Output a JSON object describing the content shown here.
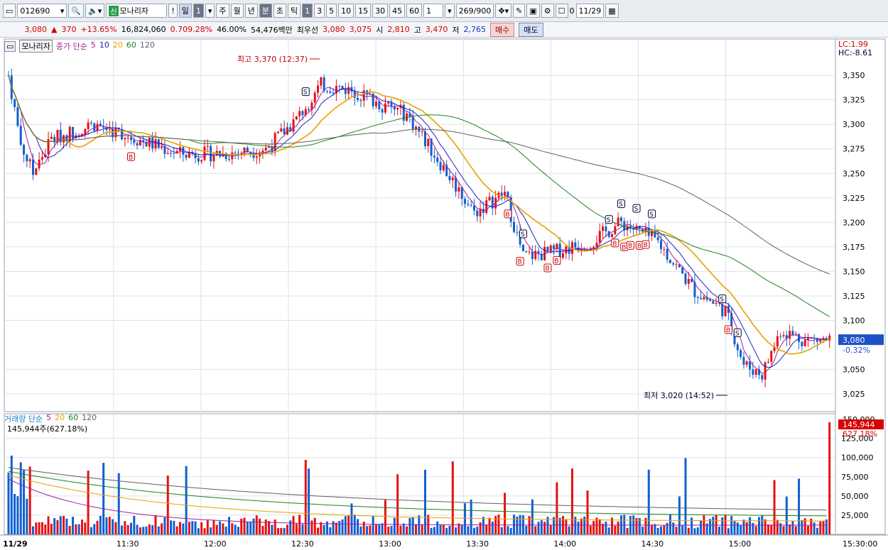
{
  "toolbar": {
    "stock_code": "012690",
    "badge": "신",
    "stock_name": "모나리자",
    "exclaim": "!",
    "period_day": "일",
    "period_num": "1",
    "tabs": [
      "주",
      "월",
      "년",
      "분",
      "초",
      "틱"
    ],
    "intervals": [
      "1",
      "3",
      "5",
      "10",
      "15",
      "30",
      "45",
      "60"
    ],
    "interval_input": "1",
    "count": "269/900",
    "date": "11/29",
    "checkbox_label": "0"
  },
  "quote": {
    "price": "3,080",
    "change_arrow": "▲",
    "change": "370",
    "change_pct": "+13.65%",
    "volume": "16,824,060",
    "volume_pct": "0.709.28%",
    "ratio": "46.00%",
    "amount": "54,476백만",
    "best_label": "최우선",
    "best_ask": "3,080",
    "best_bid": "3,075",
    "open_label": "시",
    "open": "2,810",
    "high_label": "고",
    "high": "3,470",
    "low_label": "저",
    "low": "2,765",
    "buy_label": "매수",
    "sell_label": "매도"
  },
  "price_panel": {
    "name": "모나리자",
    "legend": [
      {
        "text": "종가 단순",
        "color": "#a020a0"
      },
      {
        "text": "5",
        "color": "#a020a0"
      },
      {
        "text": "10",
        "color": "#2020c0"
      },
      {
        "text": "20",
        "color": "#e8a000"
      },
      {
        "text": "60",
        "color": "#208020"
      },
      {
        "text": "120",
        "color": "#606060"
      }
    ],
    "lc": "LC:1.99",
    "hc": "HC:-8.61",
    "high_annot": "최고 3,370 (12:37)",
    "low_annot": "최저 3,020 (14:52)",
    "cur_price": "3,080",
    "cur_pct": "-0.32%"
  },
  "volume_panel": {
    "legend": [
      {
        "text": "거래량 단순",
        "color": "#2080c0"
      },
      {
        "text": "5",
        "color": "#a020a0"
      },
      {
        "text": "20",
        "color": "#e8a000"
      },
      {
        "text": "60",
        "color": "#208020"
      },
      {
        "text": "120",
        "color": "#606060"
      }
    ],
    "info": "145,944주(627.18%)",
    "cur_vol": "145,944",
    "cur_pct": "627.18%",
    "top_tick": "150,000"
  },
  "colors": {
    "up": "#e81010",
    "down": "#1060d0",
    "grid": "#dde1e6"
  },
  "chart_data": {
    "type": "candlestick",
    "y_ticks": [
      3350,
      3325,
      3300,
      3275,
      3250,
      3225,
      3200,
      3175,
      3150,
      3125,
      3100,
      3050,
      3025
    ],
    "y_tick_labels": [
      "3,350",
      "3,325",
      "3,300",
      "3,275",
      "3,250",
      "3,225",
      "3,200",
      "3,175",
      "3,150",
      "3,125",
      "3,100",
      "3,050",
      "3,025"
    ],
    "y_range": [
      3007,
      3387
    ],
    "vol_ticks": [
      25000,
      50000,
      75000,
      100000,
      125000
    ],
    "vol_tick_labels": [
      "25,000",
      "50,000",
      "75,000",
      "100,000",
      "125,000"
    ],
    "vol_range": [
      0,
      157000
    ],
    "x_labels": [
      "11/29",
      "11:30",
      "12:00",
      "12:30",
      "13:00",
      "13:30",
      "14:00",
      "14:30",
      "15:00",
      "15:30:00"
    ],
    "x_label_minutes": [
      0,
      37,
      67,
      97,
      127,
      157,
      187,
      217,
      247,
      280
    ],
    "bars_count": 269,
    "key_points": [
      {
        "t": 0,
        "p": 3350
      },
      {
        "t": 4,
        "p": 3280
      },
      {
        "t": 8,
        "p": 3250
      },
      {
        "t": 14,
        "p": 3285
      },
      {
        "t": 28,
        "p": 3300
      },
      {
        "t": 42,
        "p": 3285
      },
      {
        "t": 56,
        "p": 3270
      },
      {
        "t": 70,
        "p": 3270
      },
      {
        "t": 84,
        "p": 3275
      },
      {
        "t": 94,
        "p": 3305
      },
      {
        "t": 102,
        "p": 3340
      },
      {
        "t": 112,
        "p": 3335
      },
      {
        "t": 122,
        "p": 3320
      },
      {
        "t": 130,
        "p": 3310
      },
      {
        "t": 140,
        "p": 3265
      },
      {
        "t": 152,
        "p": 3210
      },
      {
        "t": 162,
        "p": 3230
      },
      {
        "t": 168,
        "p": 3165
      },
      {
        "t": 178,
        "p": 3170
      },
      {
        "t": 190,
        "p": 3180
      },
      {
        "t": 200,
        "p": 3200
      },
      {
        "t": 212,
        "p": 3180
      },
      {
        "t": 224,
        "p": 3130
      },
      {
        "t": 234,
        "p": 3110
      },
      {
        "t": 240,
        "p": 3055
      },
      {
        "t": 246,
        "p": 3045
      },
      {
        "t": 252,
        "p": 3090
      },
      {
        "t": 260,
        "p": 3080
      },
      {
        "t": 268,
        "p": 3080
      }
    ],
    "markers_b": [
      "B",
      "B",
      "B",
      "B",
      "B",
      "B",
      "B",
      "B",
      "B",
      "B",
      "B"
    ],
    "markers_s": [
      "S",
      "S",
      "S",
      "S",
      "S",
      "S",
      "S",
      "S"
    ]
  }
}
